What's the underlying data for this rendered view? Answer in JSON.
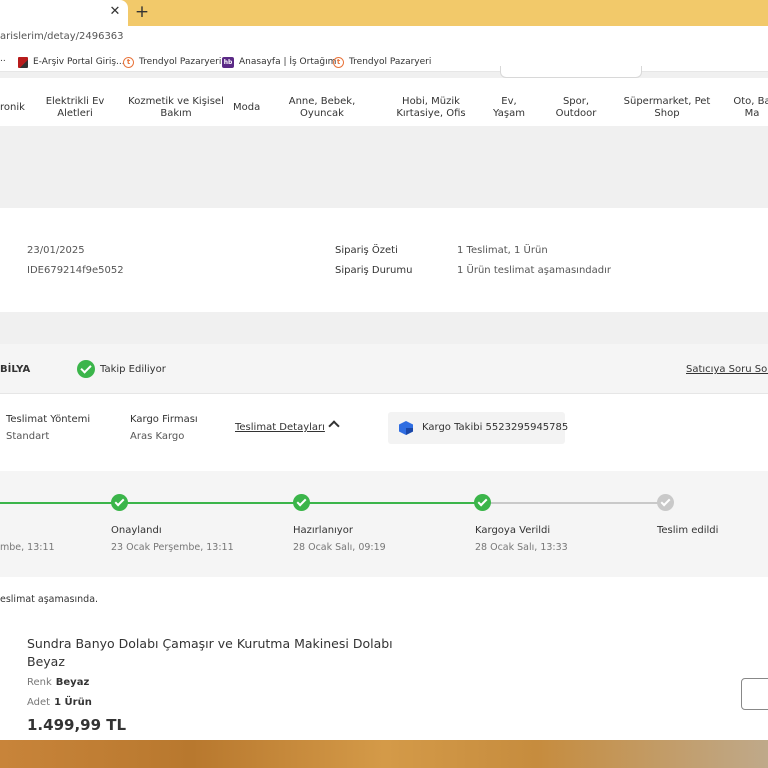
{
  "browser": {
    "new_tab_symbol": "+",
    "close_symbol": "✕",
    "url": "arislerim/detay/2496363",
    "bookmarks": [
      {
        "label": "..",
        "icon": "dots"
      },
      {
        "label": "E-Arşiv Portal Giriş...",
        "icon": "pdf-icon"
      },
      {
        "label": "Trendyol Pazaryeri",
        "icon": "trendyol-icon"
      },
      {
        "label": "Anasayfa | İş Ortağım",
        "icon": "hb-icon"
      },
      {
        "label": "Trendyol Pazaryeri",
        "icon": "trendyol-icon"
      }
    ]
  },
  "nav": {
    "items": [
      "ronik",
      "Elektrikli Ev\nAletleri",
      "Kozmetik ve Kişisel\nBakım",
      "Moda",
      "Anne, Bebek,\nOyuncak",
      "Hobi, Müzik\nKırtasiye, Ofis",
      "Ev,\nYaşam",
      "Spor,\nOutdoor",
      "Süpermarket, Pet\nShop",
      "Oto, Ba\nMa"
    ]
  },
  "order": {
    "date": "23/01/2025",
    "order_no": "IDE679214f9e5052",
    "summary_label": "Sipariş Özeti",
    "summary_value": "1 Teslimat, 1 Ürün",
    "status_label": "Sipariş Durumu",
    "status_value": "1 Ürün teslimat aşamasındadır"
  },
  "seller": {
    "name": "BİLYA",
    "tracking_status": "Takip Ediliyor",
    "ask_seller": "Satıcıya Soru Sor"
  },
  "delivery": {
    "method_label": "Teslimat Yöntemi",
    "method_value": "Standart",
    "carrier_label": "Kargo Firması",
    "carrier_value": "Aras Kargo",
    "details_link": "Teslimat Detayları",
    "tracking": "Kargo Takibi 5523295945785"
  },
  "progress": {
    "first_date_partial": "mbe, 13:11",
    "steps": [
      {
        "label": "Onaylandı",
        "date": "23 Ocak Perşembe, 13:11",
        "done": true
      },
      {
        "label": "Hazırlanıyor",
        "date": "28 Ocak Salı, 09:19",
        "done": true
      },
      {
        "label": "Kargoya Verildi",
        "date": "28 Ocak Salı, 13:33",
        "done": true
      },
      {
        "label": "Teslim edildi",
        "date": "",
        "done": false
      }
    ]
  },
  "product": {
    "status_note": "eslimat aşamasında.",
    "title": "Sundra Banyo Dolabı Çamaşır ve Kurutma Makinesi Dolabı Beyaz",
    "color_label": "Renk",
    "color_value": "Beyaz",
    "qty_label": "Adet",
    "qty_value": "1 Ürün",
    "price": "1.499,99 TL"
  }
}
